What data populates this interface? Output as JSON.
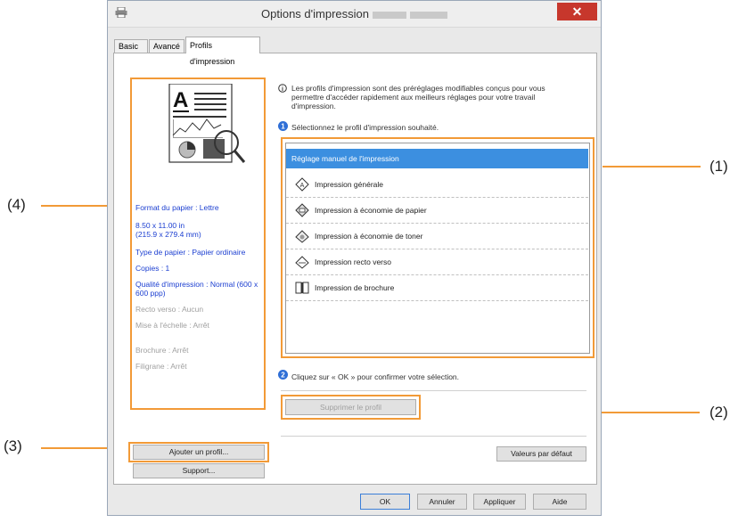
{
  "window": {
    "title": "Options d'impression"
  },
  "tabs": [
    {
      "label": "Basic"
    },
    {
      "label": "Avancé"
    },
    {
      "label": "Profils d'impression"
    }
  ],
  "summary": {
    "paper_format": "Format du papier : Lettre",
    "dims_in": "8.50 x 11.00 in",
    "dims_mm": "(215.9 x 279.4 mm)",
    "paper_type": "Type de papier : Papier ordinaire",
    "copies": "Copies : 1",
    "quality_1": "Qualité d'impression : Normal (600 x",
    "quality_2": "600 ppp)",
    "duplex": "Recto verso : Aucun",
    "scaling": "Mise à l'échelle : Arrêt",
    "brochure": "Brochure : Arrêt",
    "watermark": "Filigrane : Arrêt"
  },
  "info": {
    "line1": "Les profils d'impression sont des préréglages modifiables conçus pour vous",
    "line2": "permettre d'accéder rapidement aux meilleurs réglages pour votre travail",
    "line3": "d'impression.",
    "step1": "Sélectionnez le profil d'impression souhaité.",
    "step2": "Cliquez sur « OK » pour confirmer votre sélection."
  },
  "profiles": [
    {
      "label": "Réglage manuel de l'impression"
    },
    {
      "label": "Impression générale"
    },
    {
      "label": "Impression à économie de papier"
    },
    {
      "label": "Impression à économie de toner"
    },
    {
      "label": "Impression recto verso"
    },
    {
      "label": "Impression de brochure"
    }
  ],
  "buttons": {
    "delete_profile": "Supprimer le profil",
    "add_profile": "Ajouter un profil...",
    "support": "Support...",
    "defaults": "Valeurs par défaut",
    "ok": "OK",
    "cancel": "Annuler",
    "apply": "Appliquer",
    "help": "Aide"
  },
  "callouts": {
    "c1": "(1)",
    "c2": "(2)",
    "c3": "(3)",
    "c4": "(4)"
  },
  "colors": {
    "accent": "#f29a37",
    "selected": "#3c8fe0",
    "link": "#1c3fd1"
  },
  "icons": [
    "printer-icon",
    "close-icon",
    "info-icon",
    "step-1-icon",
    "step-2-icon",
    "document-preview-icon"
  ]
}
